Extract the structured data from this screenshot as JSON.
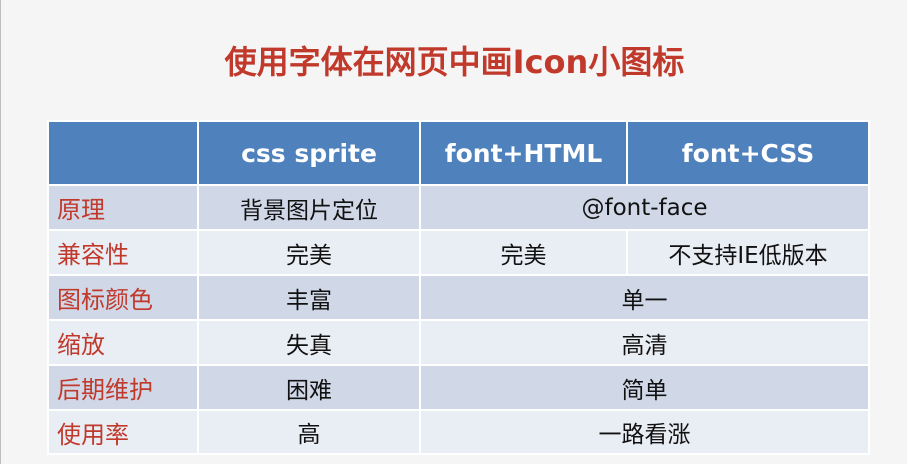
{
  "title": "使用字体在网页中画Icon小图标",
  "header": {
    "corner": "",
    "col1": "css sprite",
    "col2": "font+HTML",
    "col3": "font+CSS"
  },
  "rows": [
    {
      "label": "原理",
      "sprite": "背景图片定位",
      "font_merged": "@font-face"
    },
    {
      "label": "兼容性",
      "sprite": "完美",
      "font_html": "完美",
      "font_css": "不支持IE低版本"
    },
    {
      "label": "图标颜色",
      "sprite": "丰富",
      "font_merged": "单一"
    },
    {
      "label": "缩放",
      "sprite": "失真",
      "font_merged": "高清"
    },
    {
      "label": "后期维护",
      "sprite": "困难",
      "font_merged": "简单"
    },
    {
      "label": "使用率",
      "sprite": "高",
      "font_merged": "一路看涨"
    }
  ],
  "colors": {
    "title": "#c0392b",
    "header_bg": "#4f81bd",
    "row_odd_bg": "#d0d8e8",
    "row_even_bg": "#e9edf4",
    "row_label": "#c0392b"
  }
}
